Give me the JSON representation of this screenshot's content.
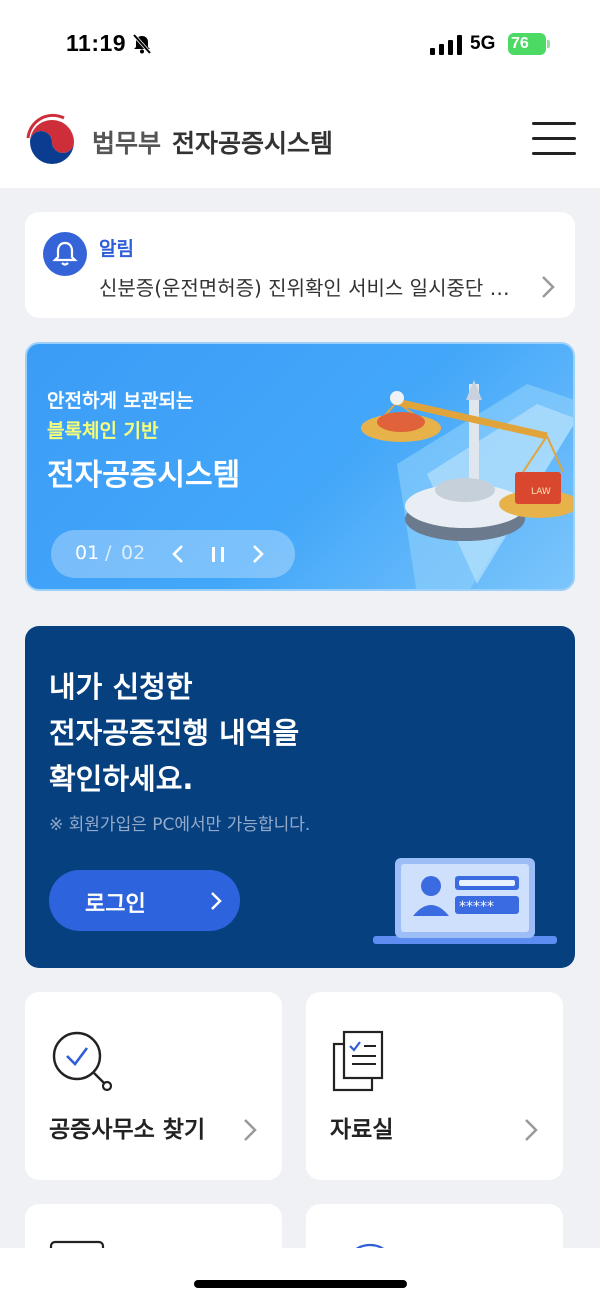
{
  "status_bar": {
    "time": "11:19",
    "network": "5G",
    "battery": "76"
  },
  "header": {
    "org": "법무부",
    "title": "전자공증시스템"
  },
  "notice": {
    "label": "알림",
    "text": "신분증(운전면허증) 진위확인 서비스 일시중단 안내"
  },
  "banner": {
    "line1": "안전하게 보관되는",
    "line2": "블록체인 기반",
    "line3": "전자공증시스템",
    "page_current": "01",
    "page_separator": "/",
    "page_total": "02",
    "book_label": "LAW"
  },
  "login_card": {
    "heading": [
      "내가 신청한",
      "전자공증진행 내역을",
      "확인하세요."
    ],
    "note": "※ 회원가입은 PC에서만 가능합니다.",
    "button_label": "로그인"
  },
  "tiles": [
    {
      "label": "공증사무소 찾기",
      "icon": "search-check-icon"
    },
    {
      "label": "자료실",
      "icon": "documents-icon"
    }
  ],
  "colors": {
    "accent": "#2f5ed9",
    "login_bg": "#06407f",
    "banner_bg": "#43a7f9",
    "page_bg": "#eff1f5"
  }
}
